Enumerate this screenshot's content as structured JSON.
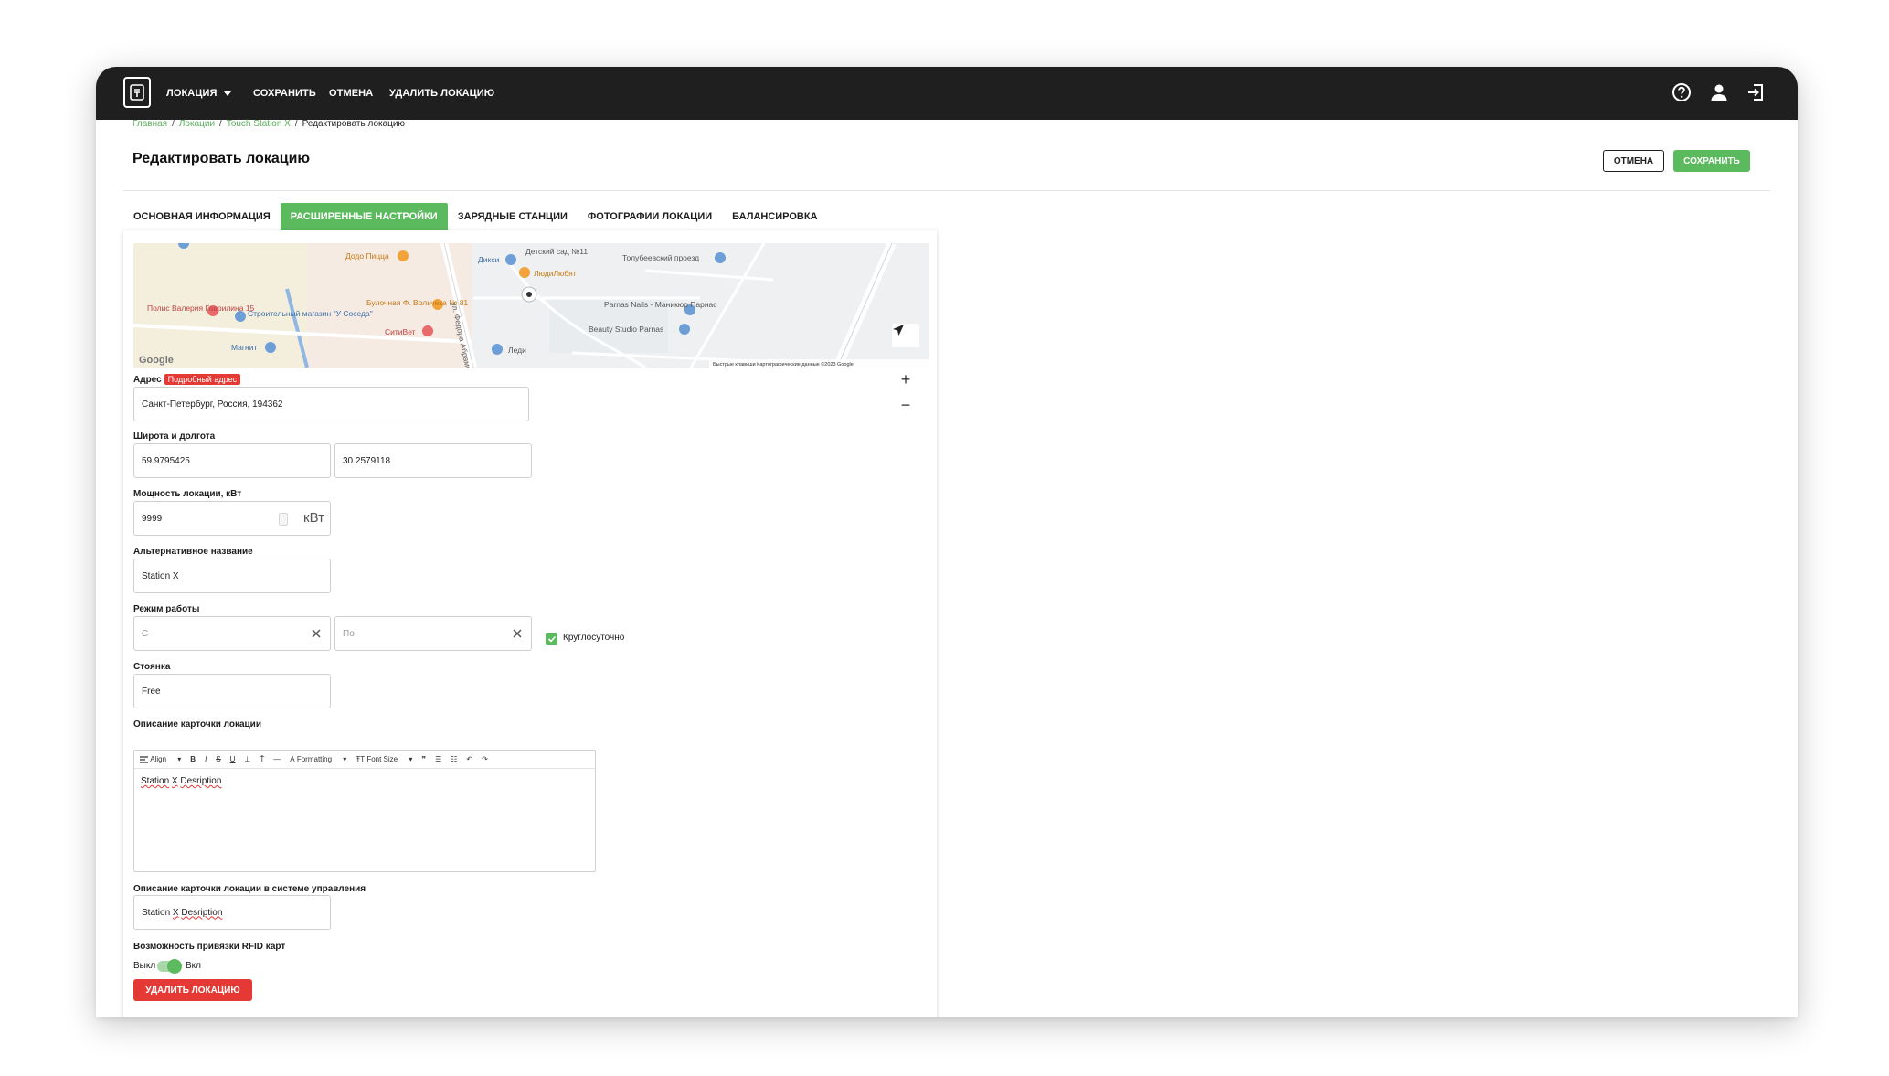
{
  "topbar": {
    "menu_location": "ЛОКАЦИЯ",
    "save": "СОХРАНИТЬ",
    "cancel": "ОТМЕНА",
    "delete_location": "УДАЛИТЬ ЛОКАЦИЮ",
    "icons": [
      "help-icon",
      "user-icon",
      "logout-icon"
    ]
  },
  "breadcrumb": {
    "items": [
      "Главная",
      "Локации",
      "Touch Station X",
      "Редактировать локацию"
    ]
  },
  "header": {
    "title": "Редактировать локацию",
    "cancel_label": "ОТМЕНА",
    "save_label": "СОХРАНИТЬ"
  },
  "tabs": [
    {
      "label": "ОСНОВНАЯ ИНФОРМАЦИЯ",
      "active": false
    },
    {
      "label": "РАСШИРЕННЫЕ НАСТРОЙКИ",
      "active": true
    },
    {
      "label": "ЗАРЯДНЫЕ СТАНЦИИ",
      "active": false
    },
    {
      "label": "ФОТОГРАФИИ ЛОКАЦИИ",
      "active": false
    },
    {
      "label": "БАЛАНСИРОВКА",
      "active": false
    }
  ],
  "map": {
    "places": {
      "p1": "Додо Пицца",
      "p2": "Дикси",
      "p3": "Детский сад №11",
      "p4": "ЛюдиЛюбят",
      "p5": "Толубеевский проезд",
      "p6": "Полис Валерия Гаврилина 15",
      "p7": "Строительный магазин \"У Соседа\"",
      "p8": "Булочная Ф. Вольчека № 81",
      "p9": "СитиВет",
      "p10": "Магнит",
      "p11": "Parnas Nails - Маникюр Парнас",
      "p12": "Beauty Studio Parnas",
      "p13": "Леди"
    },
    "street": "ул. Федора Абрамова",
    "google": "Google",
    "attribution": "Быстрые клавиши   Картографические данные ©2023 Google",
    "zoom_in": "+",
    "zoom_out": "−"
  },
  "form": {
    "address_label": "Адрес",
    "address_badge": "Подробный адрес",
    "address_value": "Санкт-Петербург, Россия, 194362",
    "coords_label": "Широта и долгота",
    "latitude": "59.9795425",
    "longitude": "30.2579118",
    "power_label": "Мощность локации, кВт",
    "power_value": "9999",
    "power_unit": "кВт",
    "alt_name_label": "Альтернативное название",
    "alt_name_value": "Station X",
    "schedule_label": "Режим работы",
    "schedule_from_placeholder": "С",
    "schedule_to_placeholder": "По",
    "around_clock_label": "Круглосуточно",
    "around_clock_checked": true,
    "parking_label": "Стоянка",
    "parking_value": "Free",
    "card_desc_label": "Описание карточки локации",
    "editor_toolbar": {
      "align": "Align",
      "formatting": "Formatting",
      "font_size": "Font Size"
    },
    "card_desc_word1": "Station",
    "card_desc_word2": "X",
    "card_desc_word3": "Desription",
    "mgmt_desc_label": "Описание карточки локации в системе управления",
    "mgmt_word1": "Station",
    "mgmt_word2": "X",
    "mgmt_word3": "Desription",
    "rfid_label": "Возможность привязки RFID карт",
    "rfid_off": "Выкл",
    "rfid_on": "Вкл",
    "rfid_enabled": true,
    "delete_button": "УДАЛИТЬ ЛОКАЦИЮ"
  },
  "colors": {
    "accent_green": "#5cba5e",
    "danger_red": "#e53935",
    "topbar_bg": "#1f1f1f",
    "link_green": "#5aae5c"
  }
}
